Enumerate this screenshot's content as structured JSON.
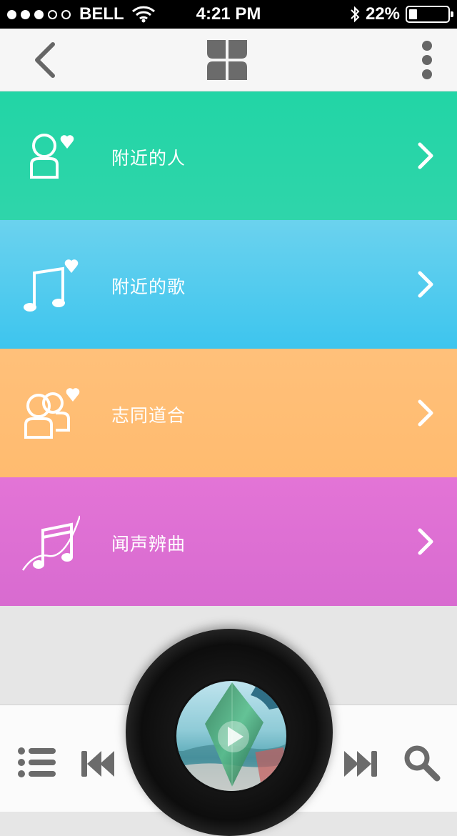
{
  "status_bar": {
    "carrier": "BELL",
    "time": "4:21 PM",
    "battery_text": "22%",
    "battery_level": 0.22,
    "signal_bars_filled": 3,
    "signal_bars_total": 5
  },
  "nav": {
    "back_icon": "chevron-left-icon",
    "logo_icon": "app-logo-icon",
    "more_icon": "vertical-dots-icon"
  },
  "menu": [
    {
      "label": "附近的人",
      "icon": "person-heart-icon",
      "color": "#22d5a6"
    },
    {
      "label": "附近的歌",
      "icon": "music-note-heart-icon",
      "color": "#4cc8ee"
    },
    {
      "label": "志同道合",
      "icon": "two-people-heart-icon",
      "color": "#ffbd73"
    },
    {
      "label": "闻声辨曲",
      "icon": "music-wave-icon",
      "color": "#de70d3"
    }
  ],
  "player": {
    "playlist_icon": "list-icon",
    "previous_icon": "skip-back-icon",
    "play_icon": "play-icon",
    "next_icon": "skip-forward-icon",
    "search_icon": "search-icon"
  },
  "colors": {
    "status_bar_bg": "#000000",
    "nav_bg": "#f6f6f6",
    "icon_gray": "#6b6b6b"
  }
}
